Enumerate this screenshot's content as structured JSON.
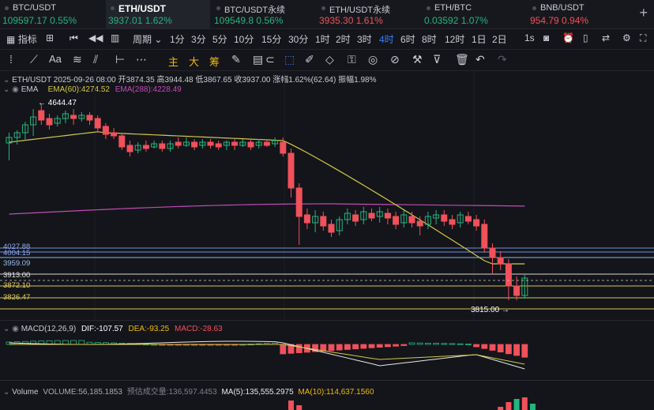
{
  "tickers": [
    {
      "symbol": "BTC/USDT",
      "price": "109597.17",
      "change": "0.55%",
      "dir": "up"
    },
    {
      "symbol": "ETH/USDT",
      "price": "3937.01",
      "change": "1.62%",
      "dir": "up"
    },
    {
      "symbol": "BTC/USDT永续",
      "price": "109549.8",
      "change": "0.56%",
      "dir": "up"
    },
    {
      "symbol": "ETH/USDT永续",
      "price": "3935.30",
      "change": "1.61%",
      "dir": "down"
    },
    {
      "symbol": "ETH/BTC",
      "price": "0.03592",
      "change": "1.07%",
      "dir": "up"
    },
    {
      "symbol": "BNB/USDT",
      "price": "954.79",
      "change": "0.94%",
      "dir": "down"
    }
  ],
  "toolbar": {
    "indicator": "指标",
    "period": "周期",
    "intervals": [
      "1分",
      "3分",
      "5分",
      "10分",
      "15分",
      "30分",
      "1时",
      "2时",
      "3时",
      "4时",
      "6时",
      "8时",
      "12时",
      "1日",
      "2日"
    ],
    "active_interval": "4时",
    "realtime": "1s"
  },
  "drawtools": {
    "main": "主",
    "large": "大",
    "raise": "筹",
    "aa": "Aa"
  },
  "info": {
    "pair": "ETH/USDT",
    "datetime": "2025-09-26 08:00",
    "open_label": "开",
    "open": "3874.35",
    "high_label": "高",
    "high": "3944.48",
    "low_label": "低",
    "low": "3867.65",
    "close_label": "收",
    "close": "3937.00",
    "chg_label": "涨幅",
    "chg": "1.62%(62.64)",
    "amp_label": "振幅",
    "amp": "1.98%"
  },
  "ema": {
    "label": "EMA",
    "ema60": "EMA(60):4274.52",
    "ema288": "EMA(288):4228.49",
    "colors": {
      "ema60": "#d4c74a",
      "ema288": "#c24bb8"
    }
  },
  "levels": [
    {
      "label": "4027.88",
      "color": "#6f8fe0"
    },
    {
      "label": "4004.15",
      "color": "#6f8fe0"
    },
    {
      "label": "3959.09",
      "color": "#8bb4e8"
    },
    {
      "label": "3913.00",
      "color": "#d8d8d8"
    },
    {
      "label": "3872.10",
      "color": "#d6c34a"
    },
    {
      "label": "3826.47",
      "color": "#d6c34a"
    }
  ],
  "annotations": {
    "high": "← 4644.47",
    "low": "3815.00 →"
  },
  "macd": {
    "label": "MACD(12,26,9)",
    "dif": "DIF:-107.57",
    "dea": "DEA:-93.25",
    "macd": "MACD:-28.63"
  },
  "volume": {
    "label": "Volume",
    "vol": "VOLUME:56,185.1853",
    "est": "预估成交量:136,597.4453",
    "ma5": "MA(5):135,555.2975",
    "ma10": "MA(10):114,637.1560"
  },
  "colors": {
    "up": "#24b47e",
    "down": "#f0515b",
    "accent": "#3d7cf7",
    "bg": "#14151a"
  }
}
